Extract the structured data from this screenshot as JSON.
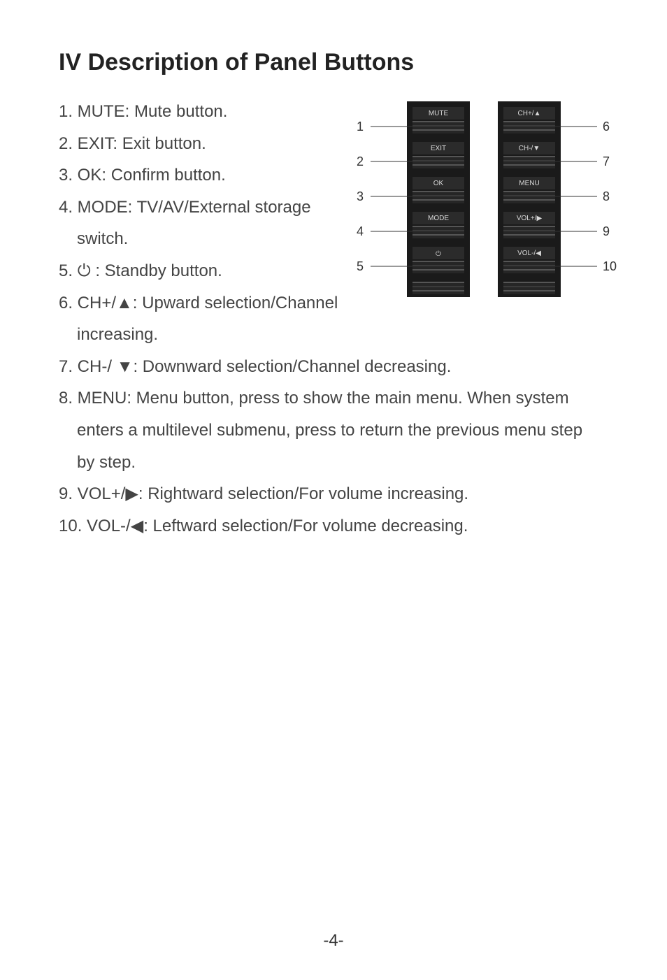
{
  "title": "IV  Description of Panel Buttons",
  "list": {
    "i1": "1. MUTE: Mute button.",
    "i2": "2. EXIT: Exit button.",
    "i3": "3. OK: Confirm button.",
    "i4a": "4. MODE: TV/AV/External storage",
    "i4b": "switch.",
    "i5a": "5. ",
    "i5b": " : Standby button.",
    "i6a": "6. CH+/",
    "i6b": ": Upward selection/Channel",
    "i6c": "increasing.",
    "i7a": "7. CH-/ ",
    "i7b": ": Downward selection/Channel decreasing.",
    "i8a": "8. MENU: Menu button, press to show the main menu. When system",
    "i8b": "enters a multilevel submenu, press to return the previous menu step",
    "i8c": "by step.",
    "i9a": "9. VOL+/",
    "i9b": ": Rightward selection/For volume increasing.",
    "i10a": "10. VOL-/",
    "i10b": ": Leftward selection/For volume decreasing."
  },
  "figure": {
    "leftNums": {
      "n1": "1",
      "n2": "2",
      "n3": "3",
      "n4": "4",
      "n5": "5"
    },
    "rightNums": {
      "n6": "6",
      "n7": "7",
      "n8": "8",
      "n9": "9",
      "n10": "10"
    },
    "labels": {
      "mute": "MUTE",
      "exit": "EXIT",
      "ok": "OK",
      "mode": "MODE",
      "chplus": "CH+/▲",
      "chminus": "CH-/▼",
      "menu": "MENU",
      "volplus": "VOL+/▶",
      "volminus": "VOL-/◀"
    }
  },
  "pageNumber": "-4-",
  "glyphs": {
    "up": "▲",
    "down": "▼",
    "left": "◀",
    "right": "▶",
    "power": "⏻"
  }
}
